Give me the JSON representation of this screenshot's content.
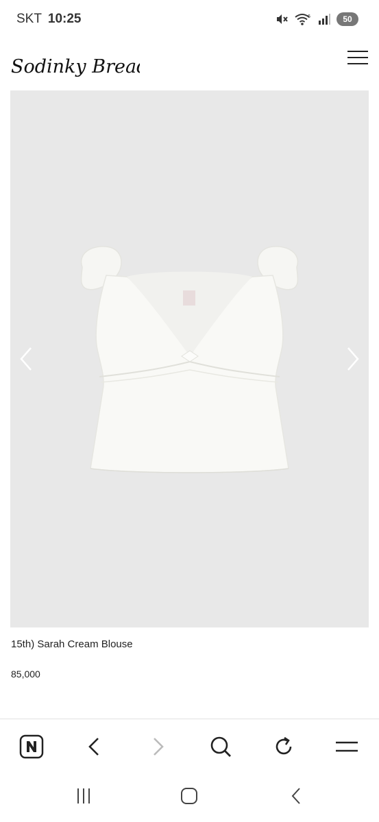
{
  "status_bar": {
    "carrier": "SKT",
    "time": "10:25",
    "battery": "50"
  },
  "header": {
    "brand": "Sodinky Bread"
  },
  "product": {
    "name": "15th) Sarah Cream Blouse",
    "price": "85,000"
  },
  "icons": {
    "browser": [
      "naver-n-icon",
      "back-arrow-icon",
      "forward-arrow-icon",
      "search-icon",
      "refresh-icon",
      "menu-icon"
    ],
    "system_nav": [
      "recent-apps-icon",
      "home-icon",
      "system-back-icon"
    ]
  }
}
